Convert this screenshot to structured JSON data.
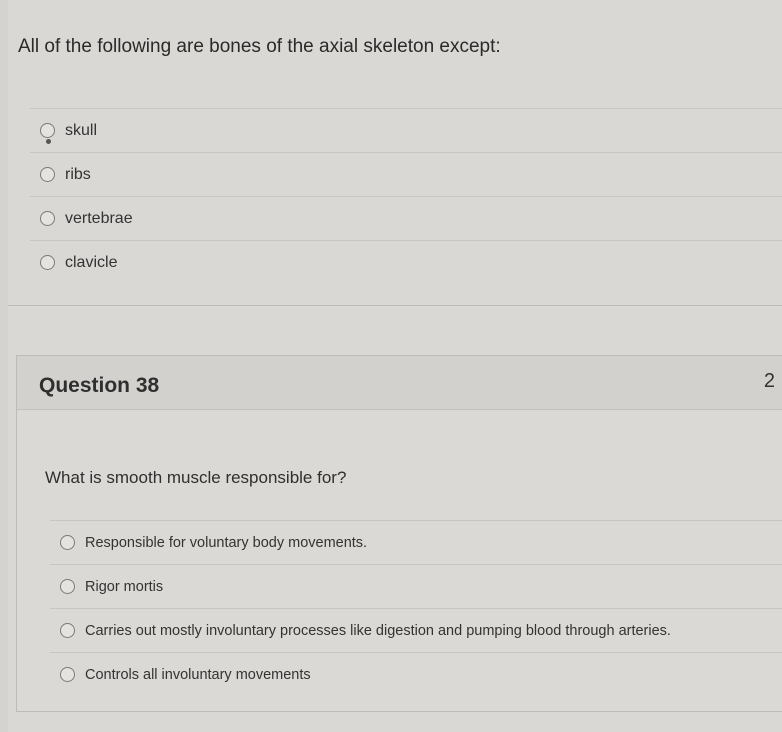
{
  "question_37": {
    "text": "All of the following are bones of the axial skeleton except:",
    "answers": [
      {
        "label": "skull"
      },
      {
        "label": "ribs"
      },
      {
        "label": "vertebrae"
      },
      {
        "label": "clavicle"
      }
    ]
  },
  "question_38": {
    "title": "Question 38",
    "points": "2",
    "text": "What is smooth muscle responsible for?",
    "answers": [
      {
        "label": "Responsible for voluntary body movements."
      },
      {
        "label": "Rigor mortis"
      },
      {
        "label": "Carries out mostly involuntary processes like digestion and pumping blood through arteries."
      },
      {
        "label": "Controls all involuntary movements"
      }
    ]
  }
}
